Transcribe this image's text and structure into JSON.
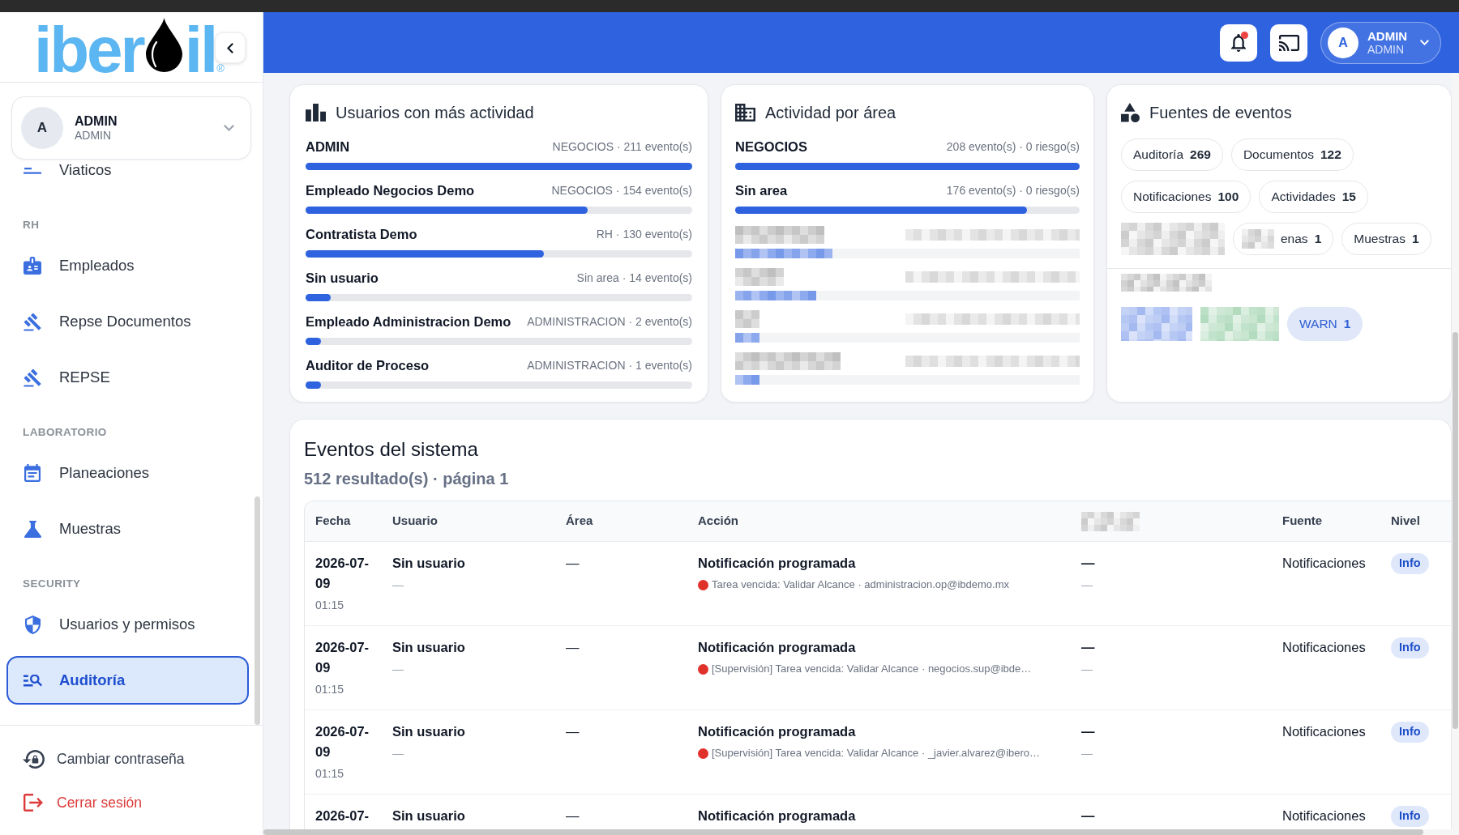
{
  "sidebar": {
    "logo": {
      "text_before": "iber",
      "text_after": "il",
      "mark": "®"
    },
    "user": {
      "initial": "A",
      "name": "ADMIN",
      "role": "ADMIN"
    },
    "sections": [
      {
        "items": [
          {
            "label": "Viaticos",
            "selected": false
          }
        ]
      },
      {
        "title": "RH",
        "items": [
          {
            "label": "Empleados",
            "selected": false
          },
          {
            "label": "Repse Documentos",
            "selected": false
          },
          {
            "label": "REPSE",
            "selected": false
          }
        ]
      },
      {
        "title": "LABORATORIO",
        "items": [
          {
            "label": "Planeaciones",
            "selected": false
          },
          {
            "label": "Muestras",
            "selected": false
          }
        ]
      },
      {
        "title": "SECURITY",
        "items": [
          {
            "label": "Usuarios y permisos",
            "selected": false
          },
          {
            "label": "Auditoría",
            "selected": true
          }
        ]
      }
    ],
    "footer": [
      {
        "kind": "normal",
        "label": "Cambiar contraseña"
      },
      {
        "kind": "danger",
        "label": "Cerrar sesión"
      }
    ]
  },
  "header": {
    "notifications_unread": true,
    "user": {
      "initial": "A",
      "name": "ADMIN",
      "role": "ADMIN"
    }
  },
  "cards": [
    {
      "kind": "bars",
      "title": "Usuarios con más actividad",
      "rows": [
        {
          "kind": "bar",
          "name": "ADMIN",
          "meta": "NEGOCIOS · 211 evento(s)",
          "level": 1
        },
        {
          "kind": "bar",
          "name": "Empleado Negocios Demo",
          "meta": "NEGOCIOS · 154 evento(s)",
          "level": 0.73
        },
        {
          "kind": "bar",
          "name": "Contratista Demo",
          "meta": "RH · 130 evento(s)",
          "level": 0.616
        },
        {
          "kind": "bar",
          "name": "Sin usuario",
          "meta": "Sin area · 14 evento(s)",
          "level": 0.066
        },
        {
          "kind": "bar",
          "name": "Empleado Administracion Demo",
          "meta": "ADMINISTRACION · 2 evento(s)",
          "level": 0.04
        },
        {
          "kind": "bar",
          "name": "Auditor de Proceso",
          "meta": "ADMINISTRACION · 1 evento(s)",
          "level": 0.04
        }
      ]
    },
    {
      "kind": "bars",
      "title": "Actividad por área",
      "rows": [
        {
          "kind": "bar",
          "name": "NEGOCIOS",
          "meta": "208 evento(s) · 0 riesgo(s)",
          "level": 1
        },
        {
          "kind": "bar",
          "name": "Sin area",
          "meta": "176 evento(s) · 0 riesgo(s)",
          "level": 0.846
        },
        {
          "kind": "pixelated"
        }
      ]
    },
    {
      "kind": "chips",
      "title": "Fuentes de eventos",
      "sources": [
        {
          "kind": "chip",
          "label": "Auditoría",
          "count": "269"
        },
        {
          "kind": "chip",
          "label": "Documentos",
          "count": "122"
        },
        {
          "kind": "chip",
          "label": "Notificaciones",
          "count": "100"
        },
        {
          "kind": "chip",
          "label": "Actividades",
          "count": "15"
        },
        {
          "kind": "pixelated"
        },
        {
          "kind": "partial",
          "label": "enas",
          "count": "1"
        },
        {
          "kind": "chip",
          "label": "Muestras",
          "count": "1"
        }
      ],
      "levels_heading": {
        "kind": "pixelated"
      },
      "levels": [
        {
          "kind": "pixelated",
          "color": "#a3b9f0"
        },
        {
          "kind": "pixelated",
          "color": "#b3dcbe"
        },
        {
          "kind": "chip",
          "label": "WARN",
          "count": "1",
          "color": "#2f5fd3"
        }
      ]
    }
  ],
  "events": {
    "title": "Eventos del sistema",
    "subtitle": "512 resultado(s) · página 1",
    "table": {
      "columns": [
        {
          "kind": "text",
          "label": "Fecha"
        },
        {
          "kind": "text",
          "label": "Usuario"
        },
        {
          "kind": "text",
          "label": "Área"
        },
        {
          "kind": "text",
          "label": "Acción"
        },
        {
          "kind": "pixelated"
        },
        {
          "kind": "text",
          "label": "Fuente"
        },
        {
          "kind": "text",
          "label": "Nivel"
        }
      ],
      "rows": [
        {
          "date": "2026-07-09",
          "time": "01:15",
          "user": "Sin usuario",
          "user_detail": "—",
          "area": "—",
          "action": "Notificación programada",
          "detail": "Tarea vencida: Validar Alcance · administracion.op@ibdemo.mx",
          "column_5": "—",
          "column_5_detail": "—",
          "source": "Notificaciones",
          "severity": "Info"
        },
        {
          "date": "2026-07-09",
          "time": "01:15",
          "user": "Sin usuario",
          "user_detail": "—",
          "area": "—",
          "action": "Notificación programada",
          "detail": "[Supervisión] Tarea vencida: Validar Alcance · negocios.sup@ibde…",
          "column_5": "—",
          "column_5_detail": "—",
          "source": "Notificaciones",
          "severity": "Info"
        },
        {
          "date": "2026-07-09",
          "time": "01:15",
          "user": "Sin usuario",
          "user_detail": "—",
          "area": "—",
          "action": "Notificación programada",
          "detail": "[Supervisión] Tarea vencida: Validar Alcance · _javier.alvarez@ibero…",
          "column_5": "—",
          "column_5_detail": "—",
          "source": "Notificaciones",
          "severity": "Info"
        },
        {
          "date": "2026-07-",
          "user": "Sin usuario",
          "area": "—",
          "action": "Notificación programada",
          "column_5": "—",
          "source": "Notificaciones",
          "severity": "Info"
        }
      ]
    }
  }
}
